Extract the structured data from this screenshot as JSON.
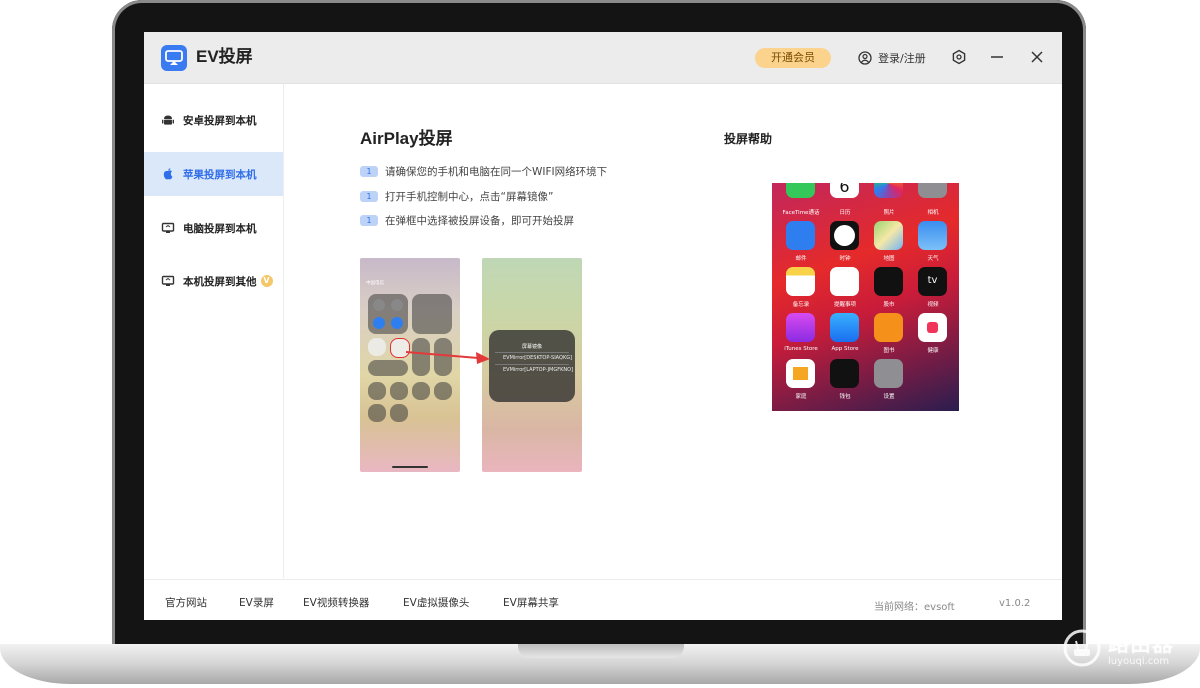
{
  "app": {
    "title": "EV投屏"
  },
  "header": {
    "vip_label": "开通会员",
    "login_label": "登录/注册"
  },
  "sidebar": {
    "items": [
      {
        "label": "安卓投屏到本机",
        "icon": "android-icon"
      },
      {
        "label": "苹果投屏到本机",
        "icon": "apple-icon",
        "active": true
      },
      {
        "label": "电脑投屏到本机",
        "icon": "monitor-icon"
      },
      {
        "label": "本机投屏到其他",
        "icon": "monitor-icon",
        "badge": "V"
      }
    ]
  },
  "main": {
    "title": "AirPlay投屏",
    "steps": [
      {
        "num": "1",
        "text": "请确保您的手机和电脑在同一个WIFI网络环境下"
      },
      {
        "num": "1",
        "text": "打开手机控制中心，点击“屏幕镜像”"
      },
      {
        "num": "1",
        "text": "在弹框中选择被投屏设备，即可开始投屏"
      }
    ],
    "screenshot1": {
      "carrier": "中国电信"
    },
    "screenshot2": {
      "popup_title": "屏幕镜像",
      "devices": [
        "EVMirror[DESKTOP-SIAQKG]",
        "EVMirror[LAPTOP-JMGFKNO]"
      ]
    }
  },
  "help": {
    "title": "投屏帮助",
    "apps": [
      [
        "FaceTime通话",
        "日历",
        "照片",
        "相机"
      ],
      [
        "邮件",
        "时钟",
        "地图",
        "天气"
      ],
      [
        "备忘录",
        "提醒事项",
        "股市",
        "视频"
      ],
      [
        "iTunes Store",
        "App Store",
        "图书",
        "健康"
      ],
      [
        "家庭",
        "钱包",
        "设置",
        ""
      ]
    ],
    "calendar_day": "6",
    "tv_label": "tv"
  },
  "footer": {
    "links": [
      "官方网站",
      "EV录屏",
      "EV视频转换器",
      "EV虚拟摄像头",
      "EV屏幕共享"
    ],
    "network": "当前网络：evsoft",
    "version": "v1.0.2"
  },
  "watermark": {
    "main": "路由器",
    "sub": "luyouqi.com"
  },
  "colors": {
    "accent": "#2f6ee8",
    "vip": "#fbd38c",
    "active_bg": "#dbe8fa"
  }
}
